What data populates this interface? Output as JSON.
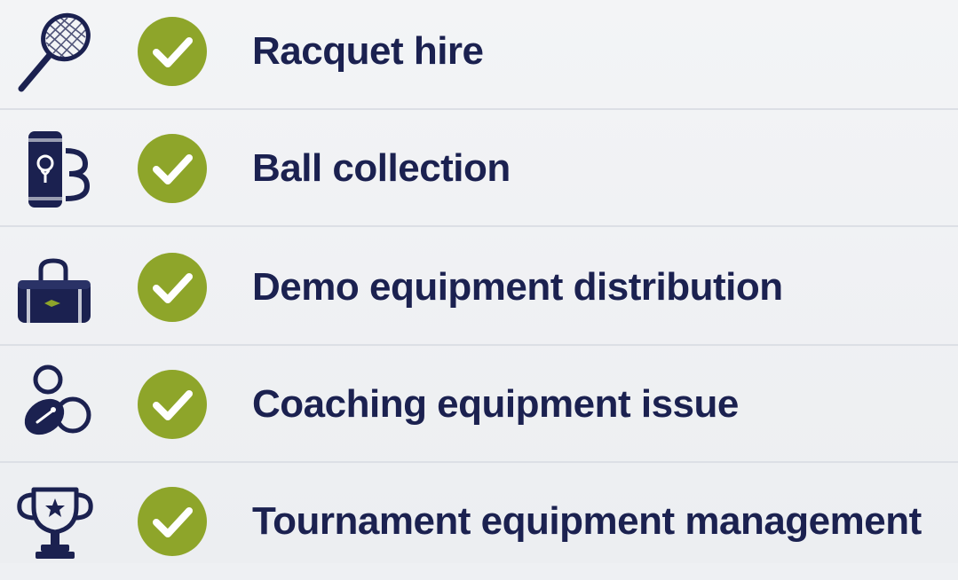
{
  "colors": {
    "navy": "#1b2150",
    "check_green": "#8ea52a",
    "check_mark": "#ffffff",
    "divider": "#dcdfe5"
  },
  "items": [
    {
      "label": "Racquet hire",
      "icon": "tennis-racquet-icon",
      "status": "checked"
    },
    {
      "label": "Ball collection",
      "icon": "ball-tube-icon",
      "status": "checked"
    },
    {
      "label": "Demo equipment distribution",
      "icon": "equipment-bag-icon",
      "status": "checked"
    },
    {
      "label": "Coaching equipment issue",
      "icon": "coaching-equipment-icon",
      "status": "checked"
    },
    {
      "label": "Tournament equipment management",
      "icon": "trophy-icon",
      "status": "checked"
    }
  ]
}
